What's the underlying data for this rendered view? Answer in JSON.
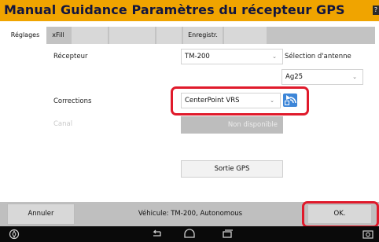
{
  "window": {
    "title": "Manual Guidance Paramètres du récepteur GPS"
  },
  "tabs": [
    {
      "label": "Réglages"
    },
    {
      "label": "xFill"
    },
    {
      "label": ""
    },
    {
      "label": ""
    },
    {
      "label": ""
    },
    {
      "label": "Enregistr."
    },
    {
      "label": ""
    }
  ],
  "form": {
    "receiver_label": "Récepteur",
    "receiver_value": "TM-200",
    "antenna_label": "Sélection d'antenne",
    "antenna_value": "Ag25",
    "corrections_label": "Corrections",
    "corrections_value": "CenterPoint VRS",
    "channel_label": "Canal",
    "channel_value": "Non disponible",
    "gps_output_button": "Sortie GPS"
  },
  "footer": {
    "cancel_label": "Annuler",
    "vehicle_text": "Véhicule: TM-200, Autonomous",
    "ok_label": "OK."
  },
  "icons": {
    "help": "help-icon",
    "centerpoint": "centerpoint-signal-icon",
    "nav": [
      "compass-icon",
      "back-icon",
      "home-icon",
      "recent-apps-icon",
      "screenshot-icon"
    ]
  },
  "colors": {
    "titlebar": "#f0a400",
    "title_text": "#11153f",
    "highlight": "#e01a2b",
    "centerpoint_icon": "#3d86d8"
  }
}
